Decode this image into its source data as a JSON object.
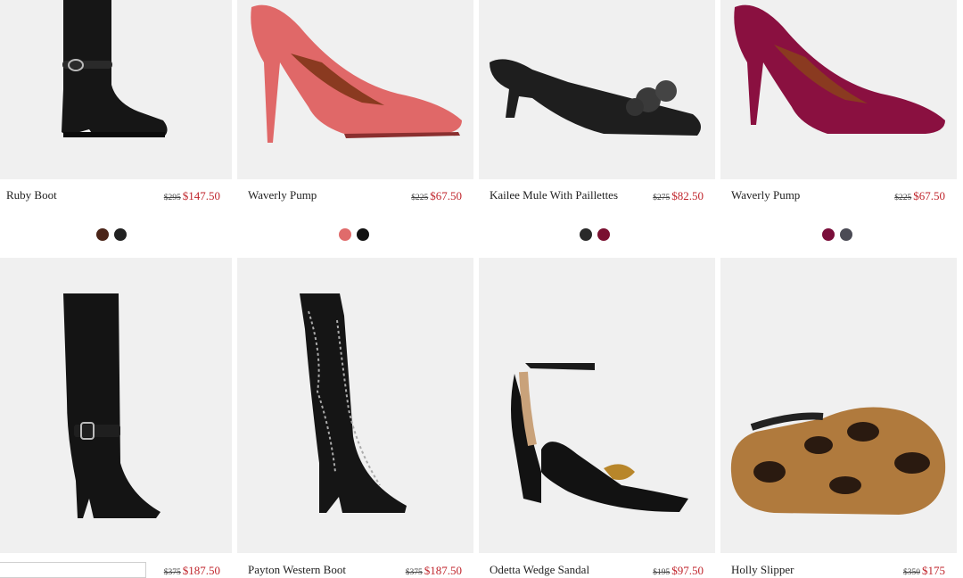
{
  "products": [
    {
      "name": "Ruby Boot",
      "old_price": "$295",
      "sale_price": "$147.50",
      "colors": [
        "#4a2418",
        "#222222"
      ],
      "image_icon": "ankle-boot-icon"
    },
    {
      "name": "Waverly Pump",
      "old_price": "$225",
      "sale_price": "$67.50",
      "colors": [
        "#e06b6b",
        "#111111"
      ],
      "image_icon": "pump-icon"
    },
    {
      "name": "Kailee Mule With Paillettes",
      "old_price": "$275",
      "sale_price": "$82.50",
      "colors": [
        "#2a2a2a",
        "#7a1030"
      ],
      "image_icon": "mule-icon"
    },
    {
      "name": "Waverly Pump",
      "old_price": "$225",
      "sale_price": "$67.50",
      "colors": [
        "#7a0e3a",
        "#4b4b55"
      ],
      "image_icon": "pump-icon"
    },
    {
      "name": "",
      "old_price": "$375",
      "sale_price": "$187.50",
      "colors": [],
      "image_icon": "tall-boot-icon"
    },
    {
      "name": "Payton Western Boot",
      "old_price": "$375",
      "sale_price": "$187.50",
      "colors": [],
      "image_icon": "western-boot-icon"
    },
    {
      "name": "Odetta Wedge Sandal",
      "old_price": "$195",
      "sale_price": "$97.50",
      "colors": [],
      "image_icon": "wedge-sandal-icon"
    },
    {
      "name": "Holly Slipper",
      "old_price": "$350",
      "sale_price": "$175",
      "colors": [],
      "image_icon": "slipper-icon"
    }
  ]
}
